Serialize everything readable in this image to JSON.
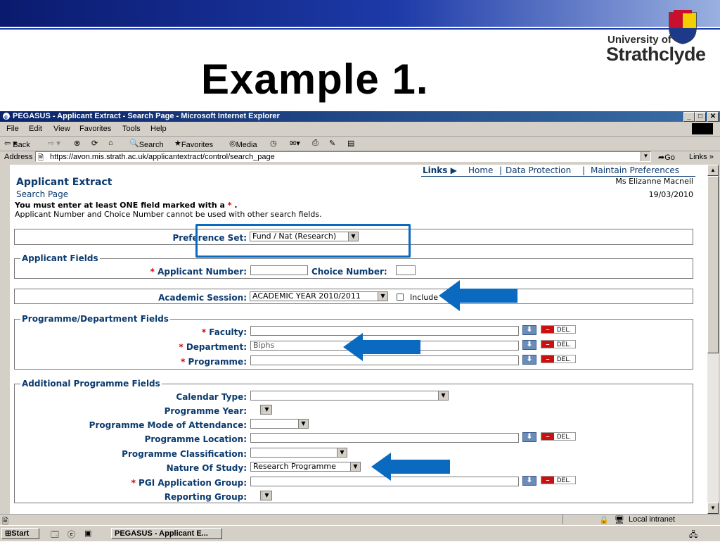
{
  "slide": {
    "title": "Example 1.",
    "logo_line1": "University of",
    "logo_line2": "Strathclyde"
  },
  "window": {
    "title": "PEGASUS - Applicant Extract - Search Page - Microsoft Internet Explorer",
    "controls": [
      "_",
      "□",
      "✕"
    ],
    "menu": [
      "File",
      "Edit",
      "View",
      "Favorites",
      "Tools",
      "Help"
    ],
    "toolbar": {
      "back": "Back",
      "search": "Search",
      "favorites": "Favorites",
      "media": "Media"
    },
    "address_label": "Address",
    "url": "https://avon.mis.strath.ac.uk/applicantextract/control/search_page",
    "go": "Go",
    "links": "Links"
  },
  "page": {
    "nav_links_label": "Links",
    "nav": [
      "Home",
      "Data Protection",
      "Maintain Preferences"
    ],
    "title": "Applicant Extract",
    "subtitle": "Search Page",
    "user": "Ms Elizanne Macneil",
    "date": "19/03/2010",
    "note_required": "You must enter at least ONE field marked with a",
    "note_required_tail": ".",
    "note_exclusive": "Applicant Number and Choice Number cannot be used with other search fields.",
    "preference_set_label": "Preference Set:",
    "preference_set_value": "Fund / Nat (Research)",
    "applicant_fields_legend": "Applicant Fields",
    "applicant_number_label": "Applicant Number:",
    "choice_number_label": "Choice Number:",
    "academic_session_label": "Academic Session:",
    "academic_session_value": "ACADEMIC YEAR 2010/2011",
    "include_label": "Include",
    "programme_legend": "Programme/Department Fields",
    "faculty_label": "Faculty:",
    "department_label": "Department:",
    "department_value": "Biphs",
    "programme_label": "Programme:",
    "del_label": "DEL.",
    "additional_legend": "Additional Programme Fields",
    "calendar_type_label": "Calendar Type:",
    "programme_year_label": "Programme Year:",
    "mode_label": "Programme Mode of Attendance:",
    "location_label": "Programme Location:",
    "classification_label": "Programme Classification:",
    "nature_label": "Nature Of Study:",
    "nature_value": "Research Programme",
    "pgi_label": "PGI Application Group:",
    "reporting_label": "Reporting Group:"
  },
  "status": {
    "zone": "Local intranet"
  },
  "taskbar": {
    "start": "Start",
    "task": "PEGASUS - Applicant E..."
  },
  "colors": {
    "label_blue": "#0b3a6e",
    "callout_blue": "#0a6ac0",
    "required_red": "#d40000"
  }
}
